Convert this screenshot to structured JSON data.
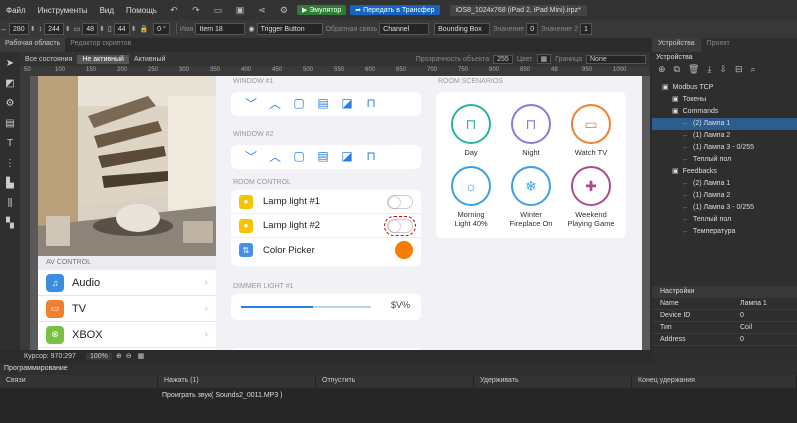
{
  "menubar": {
    "items": [
      "Файл",
      "Инструменты",
      "Вид",
      "Помощь"
    ],
    "emulator_label": "Эмулятор",
    "transfer_label": "Передать в Трансфер",
    "document_tab": "iOS8_1024x768 (iPad 2, iPad Mini).irpz*"
  },
  "propbar": {
    "x": "280",
    "y": "244",
    "w": "48",
    "h": "44",
    "angle": "0 °",
    "name_label": "Имя",
    "name_value": "Item 18",
    "type_value": "Trigger Button",
    "feedback_label": "Обратная связь",
    "feedback_value": "Channel",
    "fb_value": "Bounding Box",
    "value_label": "Значение",
    "value_value": "0",
    "value2_label": "Значение 2",
    "value2_value": "1"
  },
  "workspace": {
    "tabs": [
      "Рабочая область",
      "Редактор скриптов"
    ],
    "states": [
      "Все состояния",
      "Не активный",
      "Активный"
    ],
    "opacity_label": "Прозрачность объекта",
    "opacity_value": "255",
    "color_label": "Цвет",
    "border_label": "Граница",
    "border_value": "None"
  },
  "ruler_labels": [
    "50",
    "100",
    "150",
    "200",
    "250",
    "300",
    "350",
    "400",
    "450",
    "500",
    "550",
    "600",
    "650",
    "700",
    "750",
    "800",
    "850",
    "48",
    "950",
    "1000"
  ],
  "app": {
    "window1": "WINDOW #1",
    "window2": "WINDOW #2",
    "room_control": "ROOM CONTROL",
    "lamp1": "Lamp light #1",
    "lamp2": "Lamp light #2",
    "color_picker": "Color Picker",
    "dimmer": "DIMMER LIGHT #1",
    "dimmer_value": "$V%",
    "room_scenarios": "ROOM SCENARIOS",
    "scenes": [
      {
        "label": "Day",
        "color": "#2bb3a0"
      },
      {
        "label": "Night",
        "color": "#8b7bd8"
      },
      {
        "label": "Watch TV",
        "color": "#f08030"
      },
      {
        "label": "Morning\nLight 40%",
        "color": "#3aa0e0"
      },
      {
        "label": "Winter\nFireplace On",
        "color": "#3aa0e0"
      },
      {
        "label": "Weekend\nPlaying Game",
        "color": "#b04a8a"
      }
    ],
    "av_control": "AV CONTROL",
    "av_items": [
      {
        "label": "Audio",
        "color": "#3a8de0"
      },
      {
        "label": "TV",
        "color": "#f08030"
      },
      {
        "label": "XBOX",
        "color": "#7bc043"
      }
    ]
  },
  "statusbar": {
    "cursor": "Курсор: 970:297",
    "zoom": "100%"
  },
  "rightpanel": {
    "tabs": [
      "Устройства",
      "Проект"
    ],
    "title": "Устройства",
    "tree": [
      {
        "label": "Modbus TCP",
        "level": 0
      },
      {
        "label": "Токены",
        "level": 1
      },
      {
        "label": "Commands",
        "level": 1
      },
      {
        "label": "(2) Лампа 1",
        "level": 2,
        "selected": true
      },
      {
        "label": "(1) Лампа 2",
        "level": 2
      },
      {
        "label": "(1) Лампа 3 - 0/255",
        "level": 2
      },
      {
        "label": "Теплый пол",
        "level": 2
      },
      {
        "label": "Feedbacks",
        "level": 1
      },
      {
        "label": "(2) Лампа 1",
        "level": 2
      },
      {
        "label": "(1) Лампа 2",
        "level": 2
      },
      {
        "label": "(1) Лампа 3 - 0/255",
        "level": 2
      },
      {
        "label": "Теплый пол",
        "level": 2
      },
      {
        "label": "Температура",
        "level": 2
      }
    ],
    "settings_label": "Настройки",
    "props": [
      {
        "k": "Name",
        "v": "Лампа 1"
      },
      {
        "k": "Device ID",
        "v": "0"
      },
      {
        "k": "Тип",
        "v": "Coil"
      },
      {
        "k": "Address",
        "v": "0"
      }
    ]
  },
  "programming": {
    "title": "Программирование",
    "columns": [
      "Связи",
      "Нажать (1)",
      "Отпустить",
      "Удерживать",
      "Конец удержания"
    ],
    "action": "Проиграть звук( Sounds2_0011.MP3 )"
  }
}
